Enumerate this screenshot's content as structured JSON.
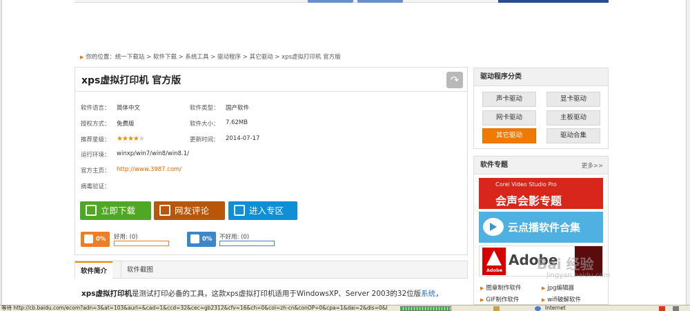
{
  "breadcrumb": {
    "prefix": "你的位置：",
    "items": [
      "统一下载站",
      "软件下载",
      "系统工具",
      "驱动程序",
      "其它驱动",
      "xps虚拟打印机 官方版"
    ],
    "separator": " > "
  },
  "software": {
    "title": "xps虚拟打印机 官方版",
    "info": {
      "language_label": "软件语言：",
      "language": "简体中文",
      "type_label": "软件类型：",
      "type": "国产软件",
      "license_label": "授权方式：",
      "license": "免费版",
      "size_label": "软件大小：",
      "size": "7.62MB",
      "rating_label": "推荐星级：",
      "rating": 4,
      "rating_max": 5,
      "updated_label": "更新时间：",
      "updated": "2014-07-17",
      "env_label": "运行环境：",
      "env": "winxp/win7/win8/win8.1/",
      "homepage_label": "官方主页：",
      "homepage": "http://www.3987.com/",
      "virus_label": "病毒验证："
    },
    "buttons": {
      "download": "立即下载",
      "comment": "网友评论",
      "enter": "进入专区"
    },
    "votes": {
      "good_pct": "0%",
      "good_label": "好用: (0)",
      "bad_pct": "0%",
      "bad_label": "不好用: (0)"
    }
  },
  "tabs": [
    "软件简介",
    "软件截图"
  ],
  "description": {
    "bold": "xps虚拟打印机",
    "text": "是测试打印必备的工具，这款xps虚拟打印机适用于WindowsXP、Server 2003的32位版",
    "link": "系统",
    "tail": "，"
  },
  "sidebar": {
    "category_title": "驱动程序分类",
    "categories": [
      "声卡驱动",
      "显卡驱动",
      "网卡驱动",
      "主板驱动",
      "其它驱动",
      "驱动合集"
    ],
    "selected_category": "其它驱动",
    "topics_title": "软件专题",
    "more": "更多>>",
    "banners": {
      "corel_small": "Corel Video Studio Pro",
      "corel": "会声会影专题",
      "cloud": "云点播软件合集",
      "adobe_logo": "Adobe",
      "adobe": "Adobe"
    },
    "topic_links": [
      "图章制作软件",
      "jpg编辑器",
      "GIF制作软件",
      "wifi破解软件"
    ]
  },
  "watermark": {
    "text": "Bai 经验",
    "sub": "jingyan.baidu.com"
  },
  "statusbar": {
    "text": "等待 http://cb.baidu.com/ecom?adn=3&at=103&aurl=&cad=1&ccd=32&cec=gb2312&cfv=16&ch=0&col=zh-cn&conOP=0&cpa=1&dai=2&dis=0&l",
    "zone": "Internet"
  },
  "colors": {
    "accent": "#f07a00",
    "download": "#4ea823",
    "comment": "#b8560a",
    "enter": "#0e8fd6",
    "link": "#e06a00"
  }
}
